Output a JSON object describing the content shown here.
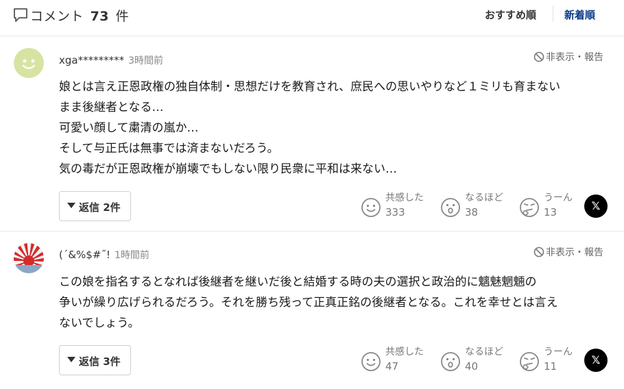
{
  "header": {
    "title_prefix": "コメント",
    "count": "73",
    "title_suffix": "件",
    "sort_recommend": "おすすめ順",
    "sort_new": "新着順",
    "accent_color": "#0b3a86"
  },
  "comments": [
    {
      "username": "xga*********",
      "time": "3時間前",
      "report_label": "非表示・報告",
      "lines": [
        "娘とは言え正恩政権の独自体制・思想だけを教育され、庶民への思いやりなど１ミリも育まない",
        "まま後継者となる…",
        "可愛い顔して粛清の嵐か…",
        "そして与正氏は無事では済まないだろう。",
        "気の毒だが正恩政権が崩壊でもしない限り民衆に平和は来ない…"
      ],
      "reply_label": "返信 2件",
      "reactions": [
        {
          "label": "共感した",
          "count": "333"
        },
        {
          "label": "なるほど",
          "count": "38"
        },
        {
          "label": "うーん",
          "count": "13"
        }
      ],
      "share_label": "𝕏"
    },
    {
      "username": "(´&%$#˝!",
      "time": "1時間前",
      "report_label": "非表示・報告",
      "lines": [
        "この娘を指名するとなれば後継者を継いだ後と結婚する時の夫の選択と政治的に魑魅魍魎の",
        "争いが繰り広げられるだろう。それを勝ち残って正真正銘の後継者となる。これを幸せとは言え",
        "ないでしょう。"
      ],
      "reply_label": "返信 3件",
      "reactions": [
        {
          "label": "共感した",
          "count": "47"
        },
        {
          "label": "なるほど",
          "count": "40"
        },
        {
          "label": "うーん",
          "count": "11"
        }
      ],
      "share_label": "𝕏"
    }
  ]
}
